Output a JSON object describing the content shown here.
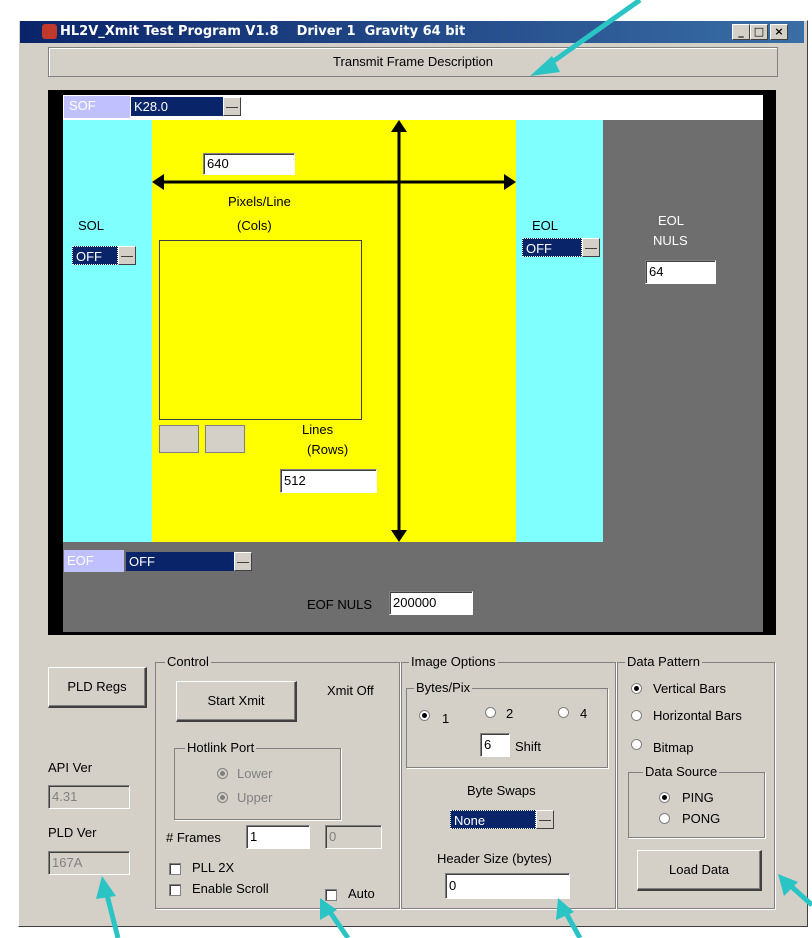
{
  "window": {
    "title": "HL2V_Xmit Test Program V1.8    Driver 1  Gravity 64 bit",
    "minimize": "_",
    "maximize": "□",
    "close": "×"
  },
  "frame_description": "Transmit Frame Description",
  "frame": {
    "sof": {
      "label": "SOF",
      "value": "K28.0"
    },
    "sol": {
      "label": "SOL",
      "value": "OFF"
    },
    "pixels_value": "640",
    "pixels_label": "Pixels/Line",
    "cols_label": "(Cols)",
    "lines_label": "Lines",
    "rows_label": "(Rows)",
    "lines_value": "512",
    "eol": {
      "label": "EOL",
      "value": "OFF"
    },
    "eol_nuls": {
      "label_line1": "EOL",
      "label_line2": "NULS",
      "value": "64"
    },
    "eof": {
      "label": "EOF",
      "value": "OFF"
    },
    "eof_nuls": {
      "label": "EOF NULS",
      "value": "200000"
    }
  },
  "left": {
    "pld_regs_button": "PLD Regs",
    "api_ver_label": "API Ver",
    "api_ver_value": "4.31",
    "pld_ver_label": "PLD Ver",
    "pld_ver_value": "167A"
  },
  "control": {
    "group_label": "Control",
    "start_xmit": "Start Xmit",
    "xmit_status": "Xmit Off",
    "hotlink_label": "Hotlink Port",
    "lower": "Lower",
    "upper": "Upper",
    "frames_label": "# Frames",
    "frames_value": "1",
    "frames_count": "0",
    "pll_2x": "PLL 2X",
    "enable_scroll": "Enable Scroll",
    "auto": "Auto"
  },
  "image_options": {
    "group_label": "Image Options",
    "bytes_pix_label": "Bytes/Pix",
    "bp_1": "1",
    "bp_2": "2",
    "bp_4": "4",
    "shift_value": "6",
    "shift_label": "Shift",
    "byte_swaps_label": "Byte Swaps",
    "byte_swaps_value": "None",
    "header_size_label": "Header Size (bytes)",
    "header_size_value": "0"
  },
  "data_pattern": {
    "group_label": "Data Pattern",
    "vertical_bars": "Vertical Bars",
    "horizontal_bars": "Horizontal Bars",
    "bitmap": "Bitmap",
    "data_source_label": "Data Source",
    "ping": "PING",
    "pong": "PONG",
    "load_data": "Load Data"
  },
  "colors": {
    "cyan": "#80ffff",
    "yellow": "#ffff00",
    "gray": "#6e6e6e",
    "arrow": "#2bc4c4",
    "navy": "#0a246a",
    "sof_label_bg": "#c0c0ff"
  }
}
